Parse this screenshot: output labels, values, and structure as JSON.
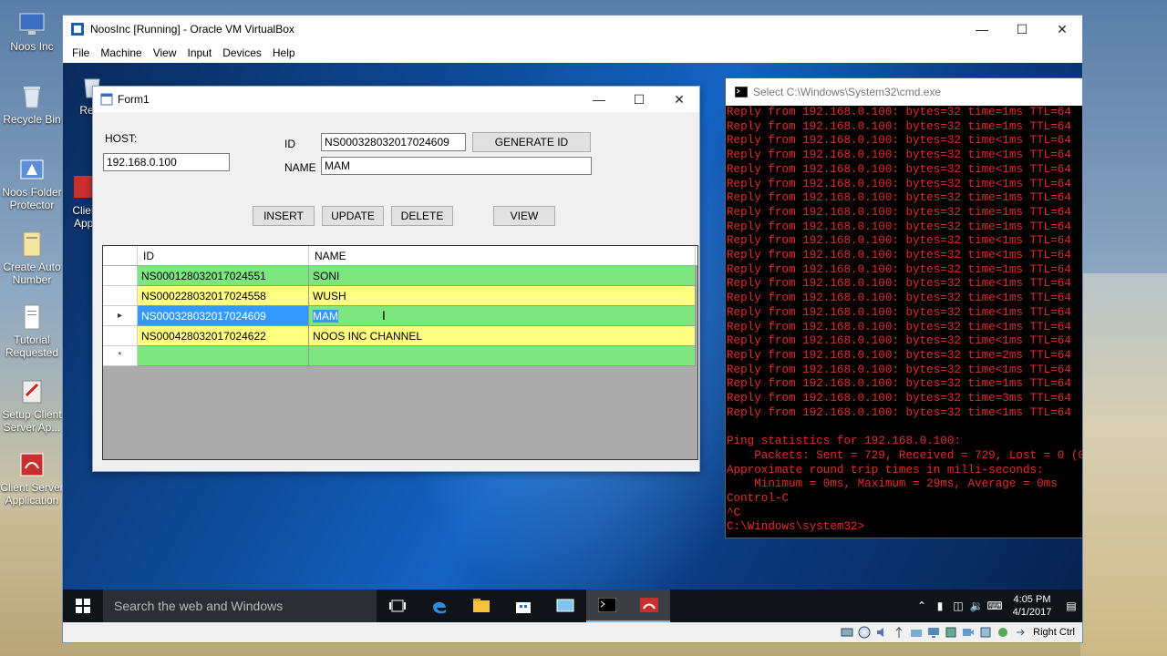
{
  "host_icons": [
    {
      "label": "Noos Inc",
      "icon": "monitor-icon"
    },
    {
      "label": "Recycle Bin",
      "icon": "recycle-bin-icon"
    },
    {
      "label": "Noos Folder Protector",
      "icon": "folder-protector-icon"
    },
    {
      "label": "Create Auto Number",
      "icon": "document-icon"
    },
    {
      "label": "Tutorial Requested",
      "icon": "text-file-icon"
    },
    {
      "label": "Setup Client Server Ap...",
      "icon": "installer-icon"
    },
    {
      "label": "Client Server Application",
      "icon": "app-icon"
    }
  ],
  "vbox": {
    "title": "NoosInc [Running] - Oracle VM VirtualBox",
    "menu": [
      "File",
      "Machine",
      "View",
      "Input",
      "Devices",
      "Help"
    ],
    "status_text": "Right Ctrl"
  },
  "vm_icons": [
    {
      "label": "Recy",
      "icon": "recycle-bin-icon"
    },
    {
      "label": "Clien Appl",
      "icon": "app-icon"
    }
  ],
  "form1": {
    "title": "Form1",
    "host_label": "HOST:",
    "host_value": "192.168.0.100",
    "id_label": "ID",
    "id_value": "NS000328032017024609",
    "name_label": "NAME",
    "name_value": "MAM",
    "buttons": {
      "generate_id": "GENERATE ID",
      "insert": "INSERT",
      "update": "UPDATE",
      "delete": "DELETE",
      "view": "VIEW"
    },
    "grid": {
      "columns": [
        "ID",
        "NAME"
      ],
      "rows": [
        {
          "id": "NS000128032017024551",
          "name": "SONI",
          "color": "#7ee67e"
        },
        {
          "id": "NS000228032017024558",
          "name": "WUSH",
          "color": "#ffff80"
        },
        {
          "id": "NS000328032017024609",
          "name": "MAM",
          "color": "#7ee67e",
          "selected": true
        },
        {
          "id": "NS000428032017024622",
          "name": "NOOS INC CHANNEL",
          "color": "#ffff80"
        },
        {
          "id": "",
          "name": "",
          "color": "#7ee67e",
          "new_row": true
        }
      ],
      "row_markers": {
        "current": "▸",
        "new": "*"
      }
    }
  },
  "cmd": {
    "title": "Select C:\\Windows\\System32\\cmd.exe",
    "lines": [
      "Reply from 192.168.0.100: bytes=32 time=1ms TTL=64",
      "Reply from 192.168.0.100: bytes=32 time=1ms TTL=64",
      "Reply from 192.168.0.100: bytes=32 time<1ms TTL=64",
      "Reply from 192.168.0.100: bytes=32 time<1ms TTL=64",
      "Reply from 192.168.0.100: bytes=32 time<1ms TTL=64",
      "Reply from 192.168.0.100: bytes=32 time<1ms TTL=64",
      "Reply from 192.168.0.100: bytes=32 time=1ms TTL=64",
      "Reply from 192.168.0.100: bytes=32 time=1ms TTL=64",
      "Reply from 192.168.0.100: bytes=32 time=1ms TTL=64",
      "Reply from 192.168.0.100: bytes=32 time<1ms TTL=64",
      "Reply from 192.168.0.100: bytes=32 time<1ms TTL=64",
      "Reply from 192.168.0.100: bytes=32 time=1ms TTL=64",
      "Reply from 192.168.0.100: bytes=32 time<1ms TTL=64",
      "Reply from 192.168.0.100: bytes=32 time<1ms TTL=64",
      "Reply from 192.168.0.100: bytes=32 time<1ms TTL=64",
      "Reply from 192.168.0.100: bytes=32 time<1ms TTL=64",
      "Reply from 192.168.0.100: bytes=32 time<1ms TTL=64",
      "Reply from 192.168.0.100: bytes=32 time=2ms TTL=64",
      "Reply from 192.168.0.100: bytes=32 time<1ms TTL=64",
      "Reply from 192.168.0.100: bytes=32 time=1ms TTL=64",
      "Reply from 192.168.0.100: bytes=32 time=3ms TTL=64",
      "Reply from 192.168.0.100: bytes=32 time<1ms TTL=64",
      "",
      "Ping statistics for 192.168.0.100:",
      "    Packets: Sent = 729, Received = 729, Lost = 0 (0",
      "Approximate round trip times in milli-seconds:",
      "    Minimum = 0ms, Maximum = 29ms, Average = 0ms",
      "Control-C",
      "^C",
      "C:\\Windows\\system32>"
    ]
  },
  "taskbar": {
    "search_placeholder": "Search the web and Windows",
    "apps": [
      "task-view-icon",
      "edge-icon",
      "file-explorer-icon",
      "store-icon",
      "control-panel-icon",
      "cmd-icon",
      "client-app-icon"
    ],
    "time": "4:05 PM",
    "date": "4/1/2017"
  },
  "colors": {
    "grid_green": "#7ee67e",
    "grid_yellow": "#ffff80",
    "selection_blue": "#3399ff",
    "cmd_text": "#e52b2b"
  }
}
